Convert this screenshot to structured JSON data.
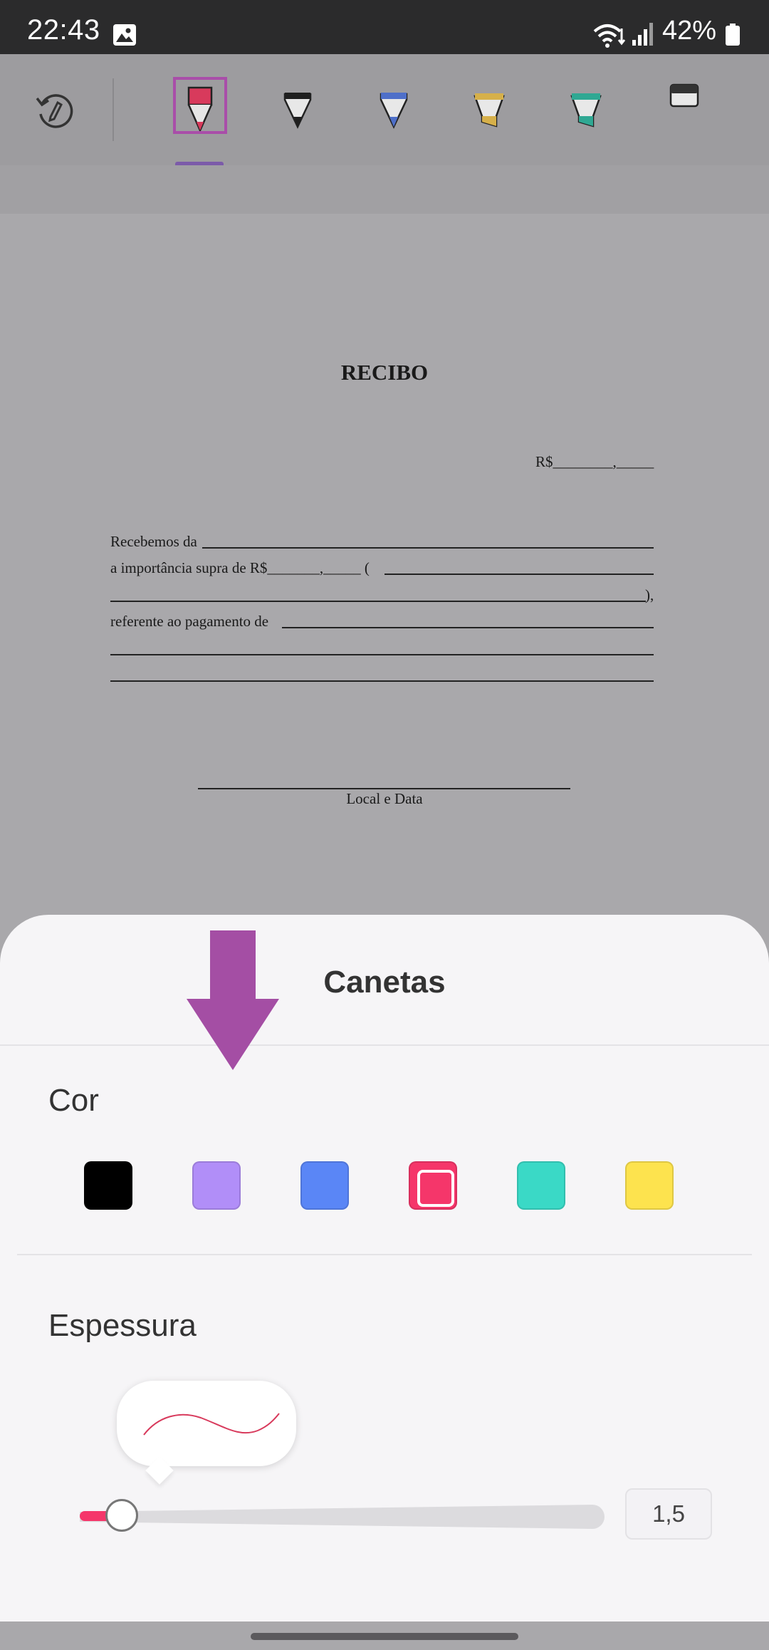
{
  "status_bar": {
    "time": "22:43",
    "battery": "42%",
    "icons": [
      "gallery-icon",
      "wifi-icon",
      "signal-icon",
      "battery-icon"
    ]
  },
  "toolbar": {
    "tools": [
      {
        "name": "undo-icon"
      },
      {
        "name": "pen-icon",
        "color": "#d83a5c",
        "selected": true
      },
      {
        "name": "marker-icon",
        "color": "#1f1f1f"
      },
      {
        "name": "marker-icon",
        "color": "#4e6fc9"
      },
      {
        "name": "highlighter-icon",
        "color": "#d6b04a"
      },
      {
        "name": "highlighter-icon",
        "color": "#2fa893"
      },
      {
        "name": "eraser-icon"
      }
    ],
    "accent": "#a94ea9"
  },
  "document": {
    "title": "RECIBO",
    "amount_line": "R$________,_____",
    "lines": [
      "Recebemos da",
      "a importância supra de R$_______,_____ (",
      "),",
      "referente ao pagamento de"
    ],
    "signature_label": "Local e Data"
  },
  "sheet": {
    "title": "Canetas",
    "color_section": "Cor",
    "colors": [
      "#000000",
      "#b18ef8",
      "#5a86f6",
      "#f5366a",
      "#3ad9c6",
      "#fde34e"
    ],
    "selected_color": "#f5366a",
    "thickness_section": "Espessura",
    "thickness_value": "1,5",
    "thickness_level": 0.08
  }
}
